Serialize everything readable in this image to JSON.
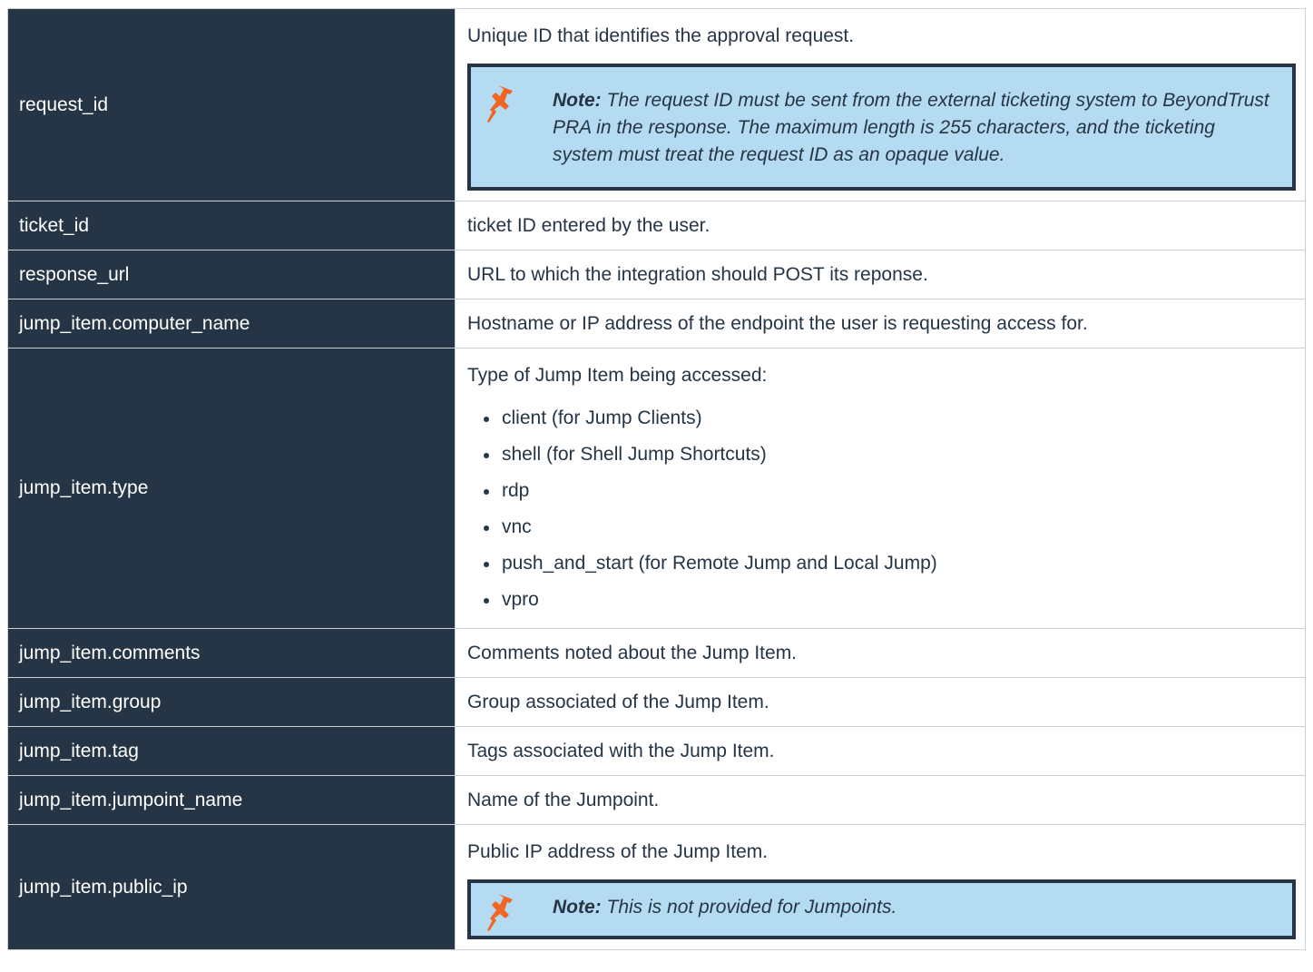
{
  "rows": [
    {
      "key": "request_id",
      "desc": "Unique ID that identifies the approval request.",
      "note": {
        "label": "Note:",
        "text": " The request ID must be sent from the external ticketing system to BeyondTrust PRA in the response. The maximum length is 255 characters, and the ticketing system must treat the request ID as an opaque value."
      }
    },
    {
      "key": "ticket_id",
      "desc": "ticket ID entered by the user."
    },
    {
      "key": "response_url",
      "desc": "URL to which the integration should POST its reponse."
    },
    {
      "key": "jump_item.computer_name",
      "desc": "Hostname or IP address of the endpoint the user is requesting access for."
    },
    {
      "key": "jump_item.type",
      "desc": "Type of Jump Item being accessed:",
      "items": [
        "client (for Jump Clients)",
        "shell (for Shell Jump Shortcuts)",
        "rdp",
        "vnc",
        "push_and_start (for Remote Jump and Local Jump)",
        "vpro"
      ]
    },
    {
      "key": "jump_item.comments",
      "desc": "Comments noted about the Jump Item."
    },
    {
      "key": "jump_item.group",
      "desc": "Group associated of the Jump Item."
    },
    {
      "key": "jump_item.tag",
      "desc": "Tags associated with the Jump Item."
    },
    {
      "key": "jump_item.jumpoint_name",
      "desc": "Name of the Jumpoint."
    },
    {
      "key": "jump_item.public_ip",
      "desc": "Public IP address of the Jump Item.",
      "note": {
        "label": "Note:",
        "text": " This is not provided for Jumpoints."
      }
    }
  ],
  "icons": {
    "note": "pushpin-icon"
  },
  "colors": {
    "key_background": "#253545",
    "note_background": "#b5dbf3",
    "note_border": "#253545",
    "pin": "#f26522"
  }
}
